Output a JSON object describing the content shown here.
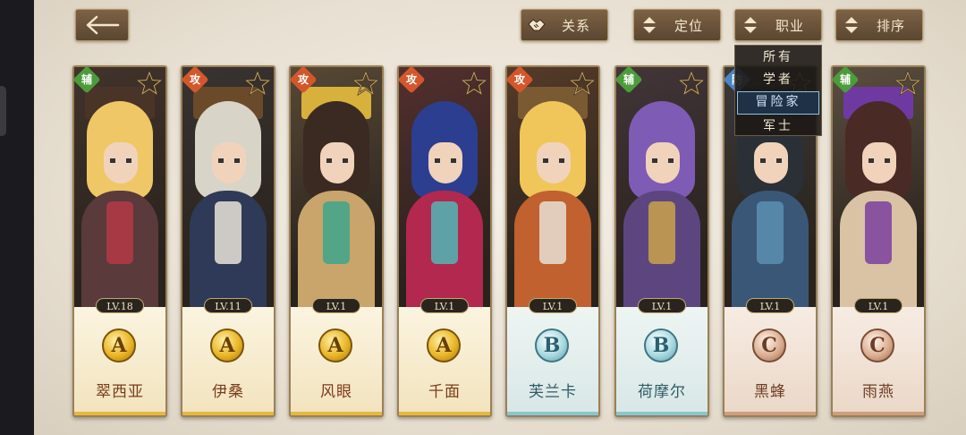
{
  "toolbar": {
    "relation_label": "关系",
    "position_label": "定位",
    "job_label": "职业",
    "sort_label": "排序"
  },
  "dropdown": {
    "options": [
      "所有",
      "学者",
      "冒险家",
      "军士"
    ],
    "selected": "冒险家"
  },
  "colors": {
    "support": "#4c9c3b",
    "attack": "#d4572b",
    "defense": "#4a86c5",
    "grade_a": "#e9b627",
    "grade_b": "#7cc3cd",
    "grade_c": "#c98e6e"
  },
  "cards": [
    {
      "role": "辅",
      "level": "LV.18",
      "grade": "A",
      "name": "翠西亚"
    },
    {
      "role": "攻",
      "level": "LV.11",
      "grade": "A",
      "name": "伊桑"
    },
    {
      "role": "攻",
      "level": "LV.1",
      "grade": "A",
      "name": "风眼"
    },
    {
      "role": "攻",
      "level": "LV.1",
      "grade": "A",
      "name": "千面"
    },
    {
      "role": "攻",
      "level": "LV.1",
      "grade": "B",
      "name": "芙兰卡"
    },
    {
      "role": "辅",
      "level": "LV.1",
      "grade": "B",
      "name": "荷摩尔"
    },
    {
      "role": "防",
      "level": "LV.1",
      "grade": "C",
      "name": "黑蜂"
    },
    {
      "role": "辅",
      "level": "LV.1",
      "grade": "C",
      "name": "雨燕"
    }
  ]
}
